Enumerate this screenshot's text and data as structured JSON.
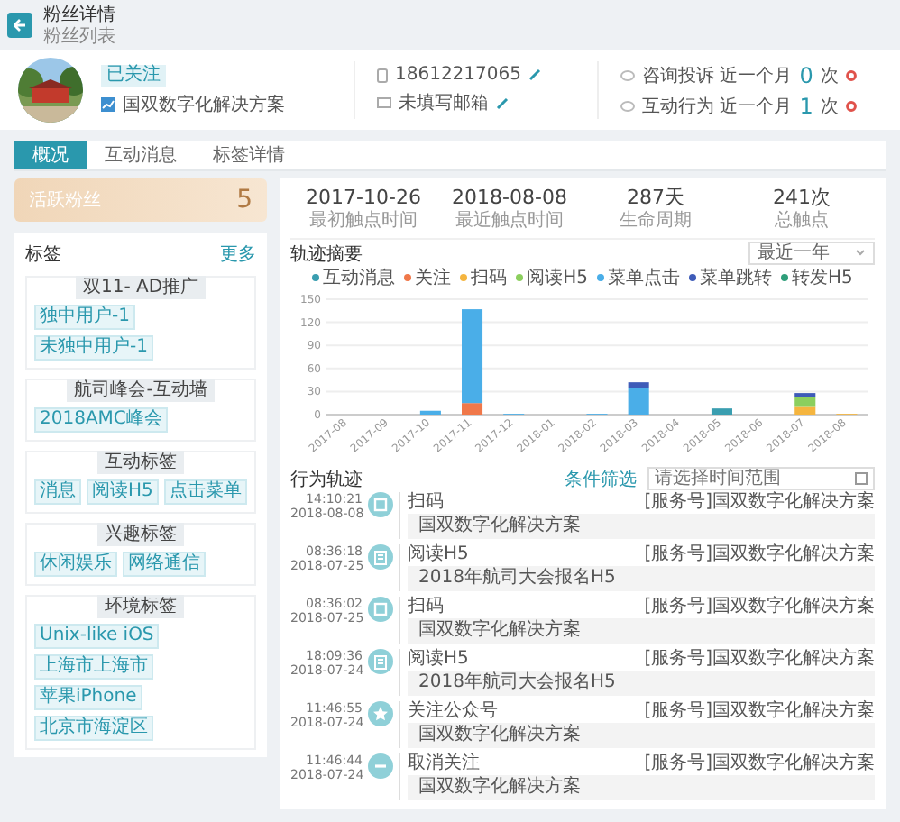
{
  "header": {
    "title": "粉丝详情",
    "breadcrumb": "粉丝列表"
  },
  "profile": {
    "status": "已关注",
    "account": "国双数字化解决方案",
    "phone": "18612217065",
    "email": "未填写邮箱",
    "metrics": [
      {
        "label": "咨询投诉 近一个月",
        "value": "0",
        "unit": "次"
      },
      {
        "label": "互动行为 近一个月",
        "value": "1",
        "unit": "次"
      }
    ]
  },
  "tabs": [
    {
      "label": "概况",
      "selected": true
    },
    {
      "label": "互动消息",
      "selected": false
    },
    {
      "label": "标签详情",
      "selected": false
    }
  ],
  "score_card": {
    "label": "活跃粉丝",
    "value": "5"
  },
  "tags": {
    "title": "标签",
    "more": "更多",
    "groups": [
      {
        "name": "双11- AD推广",
        "tags": [
          "独中用户-1",
          "未独中用户-1"
        ]
      },
      {
        "name": "航司峰会-互动墙",
        "tags": [
          "2018AMC峰会"
        ]
      },
      {
        "name": "互动标签",
        "tags": [
          "消息",
          "阅读H5",
          "点击菜单"
        ]
      },
      {
        "name": "兴趣标签",
        "tags": [
          "休闲娱乐",
          "网络通信"
        ]
      },
      {
        "name": "环境标签",
        "tags": [
          "Unix-like iOS",
          "上海市上海市",
          "苹果iPhone",
          "北京市海淀区"
        ]
      }
    ]
  },
  "stats": [
    {
      "value": "2017-10-26",
      "label": "最初触点时间"
    },
    {
      "value": "2018-08-08",
      "label": "最近触点时间"
    },
    {
      "value": "287天",
      "label": "生命周期"
    },
    {
      "value": "241次",
      "label": "总触点"
    }
  ],
  "trajectory": {
    "title": "轨迹摘要",
    "range": "最近一年",
    "chart_data": {
      "type": "bar",
      "stacked": true,
      "categories": [
        "2017-08",
        "2017-09",
        "2017-10",
        "2017-11",
        "2017-12",
        "2018-01",
        "2018-02",
        "2018-03",
        "2018-04",
        "2018-05",
        "2018-06",
        "2018-07",
        "2018-08"
      ],
      "ylim": [
        0,
        150
      ],
      "grid": true,
      "yticks": [
        0,
        30,
        60,
        90,
        120,
        150
      ],
      "series": [
        {
          "name": "互动消息",
          "color": "#3a9eb0",
          "values": [
            0,
            0,
            0,
            0,
            0,
            0,
            0,
            0,
            0,
            8,
            0,
            0,
            0
          ]
        },
        {
          "name": "关注",
          "color": "#f0784a",
          "values": [
            0,
            0,
            0,
            15,
            0,
            0,
            0,
            0,
            0,
            0,
            0,
            0,
            0
          ]
        },
        {
          "name": "扫码",
          "color": "#f5b53f",
          "values": [
            0,
            0,
            0,
            0,
            0,
            0,
            0,
            0,
            0,
            0,
            0,
            10,
            1
          ]
        },
        {
          "name": "阅读H5",
          "color": "#8ccf5e",
          "values": [
            0,
            0,
            0,
            0,
            0,
            0,
            0,
            0,
            0,
            0,
            0,
            13,
            0
          ]
        },
        {
          "name": "菜单点击",
          "color": "#4aaee8",
          "values": [
            0,
            0,
            5,
            122,
            1,
            0,
            1,
            35,
            0,
            0,
            0,
            0,
            0
          ]
        },
        {
          "name": "菜单跳转",
          "color": "#3e5bb8",
          "values": [
            0,
            0,
            0,
            0,
            0,
            0,
            0,
            7,
            0,
            0,
            0,
            5,
            0
          ]
        },
        {
          "name": "转发H5",
          "color": "#2e9e7a",
          "values": [
            0,
            0,
            0,
            0,
            0,
            0,
            0,
            0,
            0,
            0,
            0,
            0,
            0
          ]
        }
      ]
    }
  },
  "timeline": {
    "title": "行为轨迹",
    "filter": "条件筛选",
    "placeholder": "请选择时间范围",
    "events": [
      {
        "time": "14:10:21",
        "date": "2018-08-08",
        "kind": "scan",
        "title": "扫码",
        "source": "[服务号]国双数字化解决方案",
        "content": "国双数字化解决方案"
      },
      {
        "time": "08:36:18",
        "date": "2018-07-25",
        "kind": "read",
        "title": "阅读H5",
        "source": "[服务号]国双数字化解决方案",
        "content": "2018年航司大会报名H5"
      },
      {
        "time": "08:36:02",
        "date": "2018-07-25",
        "kind": "scan",
        "title": "扫码",
        "source": "[服务号]国双数字化解决方案",
        "content": "国双数字化解决方案"
      },
      {
        "time": "18:09:36",
        "date": "2018-07-24",
        "kind": "read",
        "title": "阅读H5",
        "source": "[服务号]国双数字化解决方案",
        "content": "2018年航司大会报名H5"
      },
      {
        "time": "11:46:55",
        "date": "2018-07-24",
        "kind": "follow",
        "title": "关注公众号",
        "source": "[服务号]国双数字化解决方案",
        "content": "国双数字化解决方案"
      },
      {
        "time": "11:46:44",
        "date": "2018-07-24",
        "kind": "unfollow",
        "title": "取消关注",
        "source": "[服务号]国双数字化解决方案",
        "content": "国双数字化解决方案"
      }
    ]
  }
}
